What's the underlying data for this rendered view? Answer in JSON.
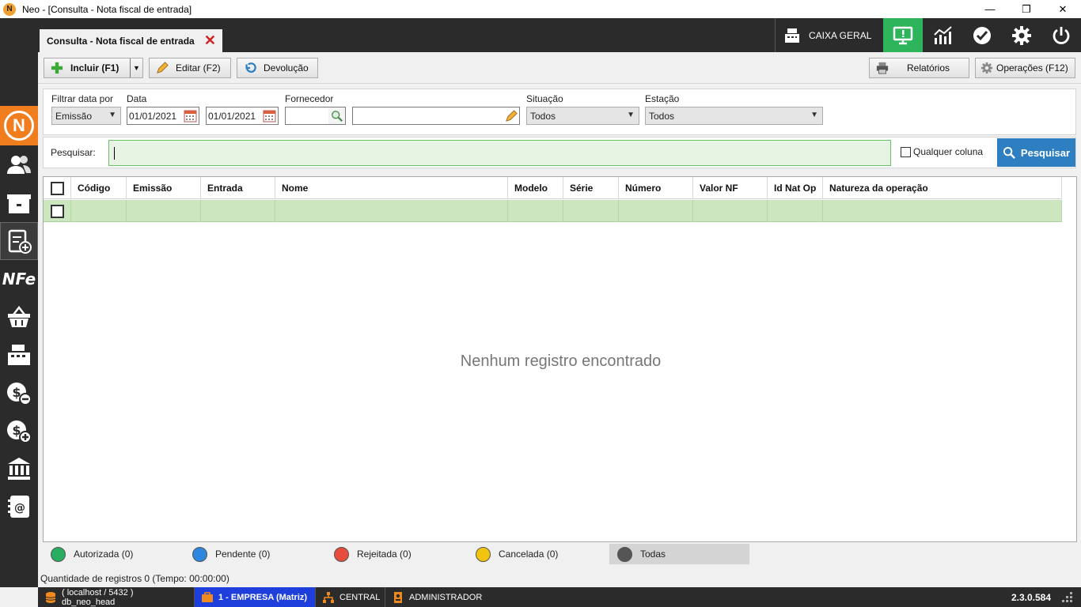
{
  "window": {
    "title": "Neo - [Consulta - Nota fiscal de entrada]",
    "app_icon_letter": "N"
  },
  "tab": {
    "label": "Consulta - Nota fiscal de entrada"
  },
  "topbar": {
    "caixa_label": "CAIXA GERAL",
    "icons": [
      "monitor-icon",
      "chart-icon",
      "check-badge-icon",
      "gear-icon",
      "power-icon"
    ]
  },
  "sidebar": {
    "items": [
      "people-icon",
      "box-icon",
      "clipboard-add-icon",
      "nfe-icon",
      "basket-icon",
      "cash-register-icon",
      "money-minus-icon",
      "money-plus-icon",
      "bank-icon",
      "contacts-icon"
    ],
    "nfe_text": "NFe"
  },
  "toolbar": {
    "incluir": "Incluir (F1)",
    "editar": "Editar (F2)",
    "devolucao": "Devolução",
    "relatorios": "Relatórios",
    "operacoes": "Operações (F12)"
  },
  "filters": {
    "filtrar_label": "Filtrar data por",
    "filtrar_value": "Emissão",
    "data_label": "Data",
    "data_from": "01/01/2021",
    "data_to": "01/01/2021",
    "fornecedor_label": "Fornecedor",
    "fornecedor_code": "",
    "fornecedor_name": "",
    "situacao_label": "Situação",
    "situacao_value": "Todos",
    "estacao_label": "Estação",
    "estacao_value": "Todos"
  },
  "search": {
    "label": "Pesquisar:",
    "value": "",
    "qualquer_coluna": "Qualquer coluna",
    "button": "Pesquisar"
  },
  "grid": {
    "columns": [
      "Código",
      "Emissão",
      "Entrada",
      "Nome",
      "Modelo",
      "Série",
      "Número",
      "Valor NF",
      "Id Nat Op",
      "Natureza da operação"
    ],
    "empty_message": "Nenhum registro encontrado"
  },
  "legend": {
    "autorizada": "Autorizada (0)",
    "pendente": "Pendente (0)",
    "rejeitada": "Rejeitada (0)",
    "cancelada": "Cancelada (0)",
    "todas": "Todas",
    "colors": {
      "autorizada": "#27ae60",
      "pendente": "#2e86de",
      "rejeitada": "#e74c3c",
      "cancelada": "#f1c40f",
      "todas": "#555555"
    }
  },
  "status": {
    "quantidade": "Quantidade de registros 0 (Tempo: 00:00:00)"
  },
  "bottombar": {
    "db": "( localhost / 5432 ) db_neo_head",
    "empresa": "1 - EMPRESA (Matriz)",
    "central": "CENTRAL",
    "user": "ADMINISTRADOR",
    "version": "2.3.0.584"
  },
  "colors": {
    "accent_orange": "#f07e1e",
    "active_green": "#2eb45a",
    "search_blue": "#2d7fc1",
    "empresa_blue": "#1f3fdc",
    "dark_bg": "#2b2b2b"
  }
}
